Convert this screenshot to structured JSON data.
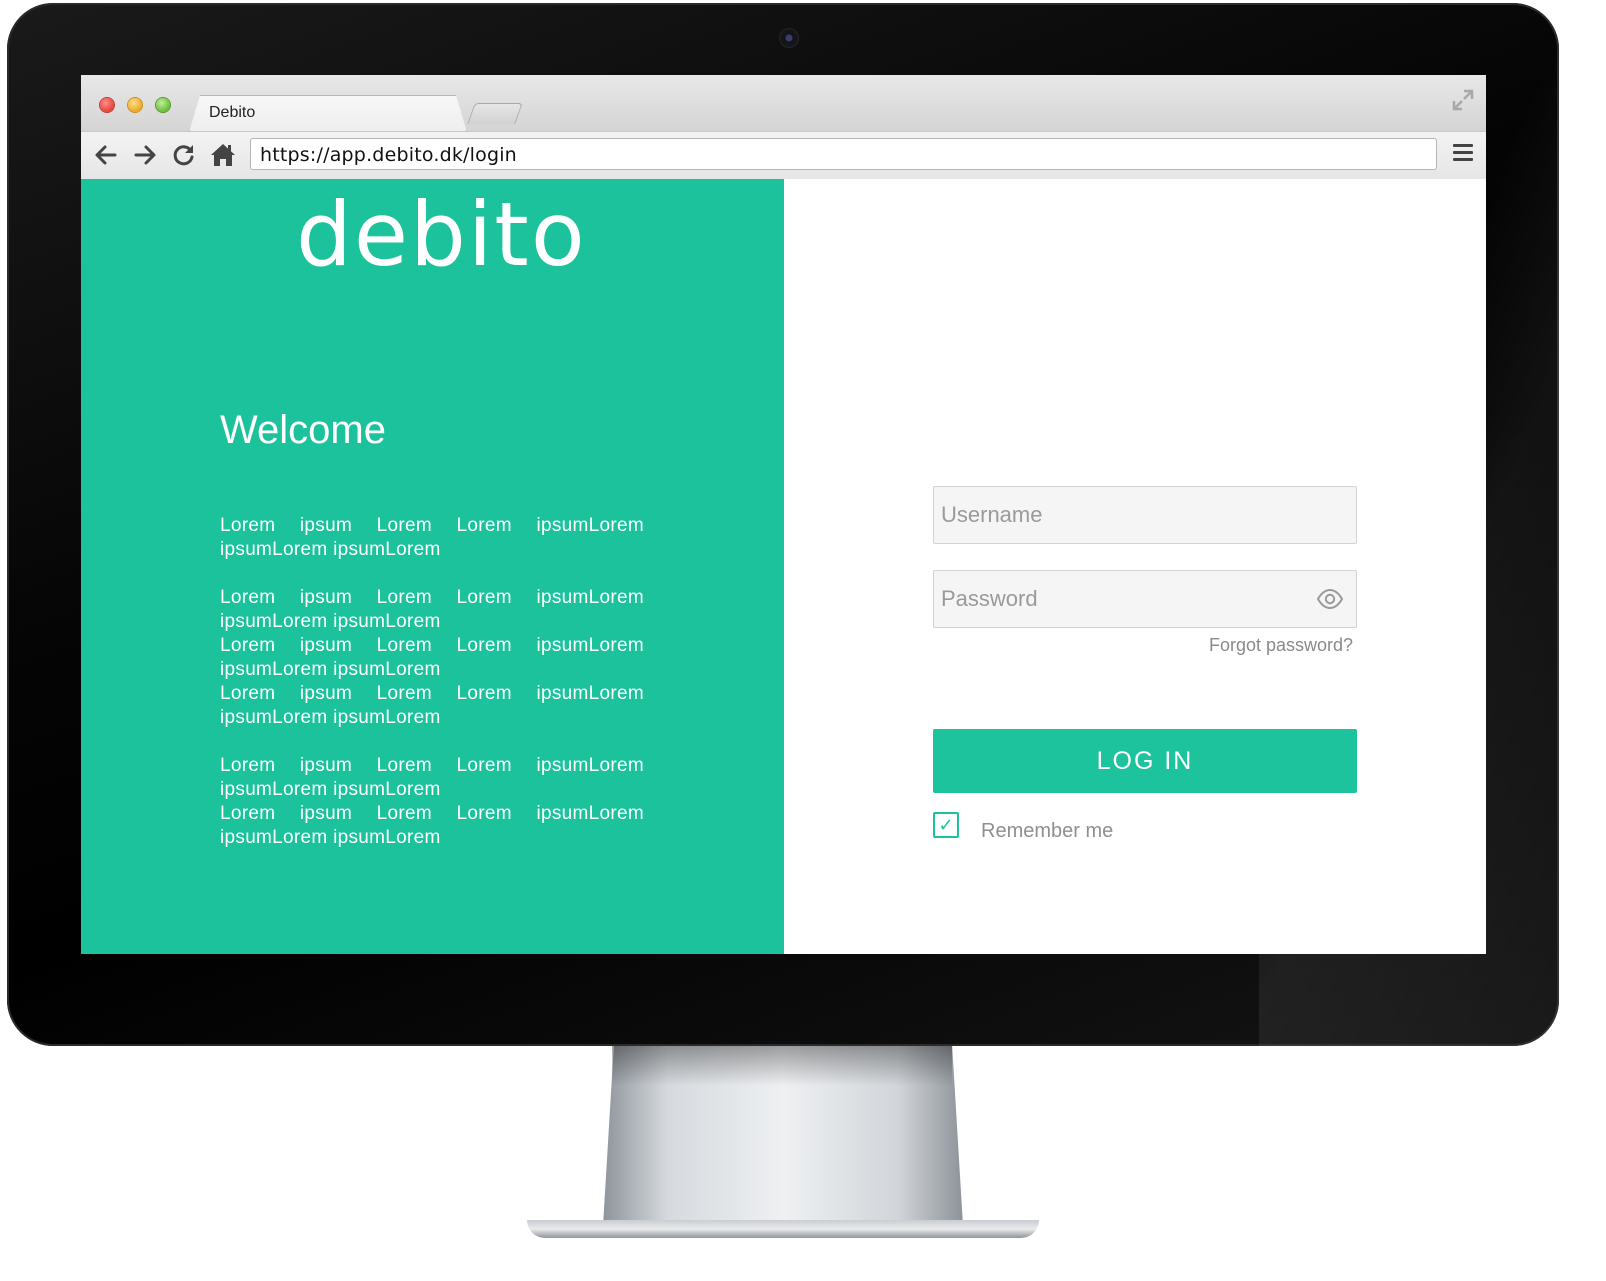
{
  "browser": {
    "tab_title": "Debito",
    "url": "https://app.debito.dk/login"
  },
  "icons": {
    "back": "arrow-left-icon",
    "forward": "arrow-right-icon",
    "reload": "reload-icon",
    "home": "home-icon",
    "menu": "hamburger-menu-icon",
    "expand": "expand-icon",
    "show_password": "eye-icon",
    "checkbox": "checkmark-icon"
  },
  "brand": {
    "logo_text": "debito",
    "accent_color": "#1bc29c"
  },
  "left_panel": {
    "welcome": "Welcome",
    "paragraphs": [
      [
        "Lorem ipsum Lorem Lorem ipsumLorem ipsumLorem ipsumLorem"
      ],
      [
        "Lorem ipsum Lorem Lorem ipsumLorem ipsumLorem ipsumLorem",
        "Lorem ipsum Lorem Lorem ipsumLorem ipsumLorem ipsumLorem",
        "Lorem ipsum Lorem Lorem ipsumLorem ipsumLorem ipsumLorem"
      ],
      [
        "Lorem ipsum Lorem Lorem ipsumLorem ipsumLorem ipsumLorem",
        "Lorem ipsum Lorem Lorem ipsumLorem ipsumLorem ipsumLorem"
      ]
    ]
  },
  "login_form": {
    "username_placeholder": "Username",
    "username_value": "",
    "password_placeholder": "Password",
    "password_value": "",
    "forgot_password": "Forgot password?",
    "login_button": "LOG IN",
    "remember_me_label": "Remember me",
    "remember_me_checked": true
  }
}
